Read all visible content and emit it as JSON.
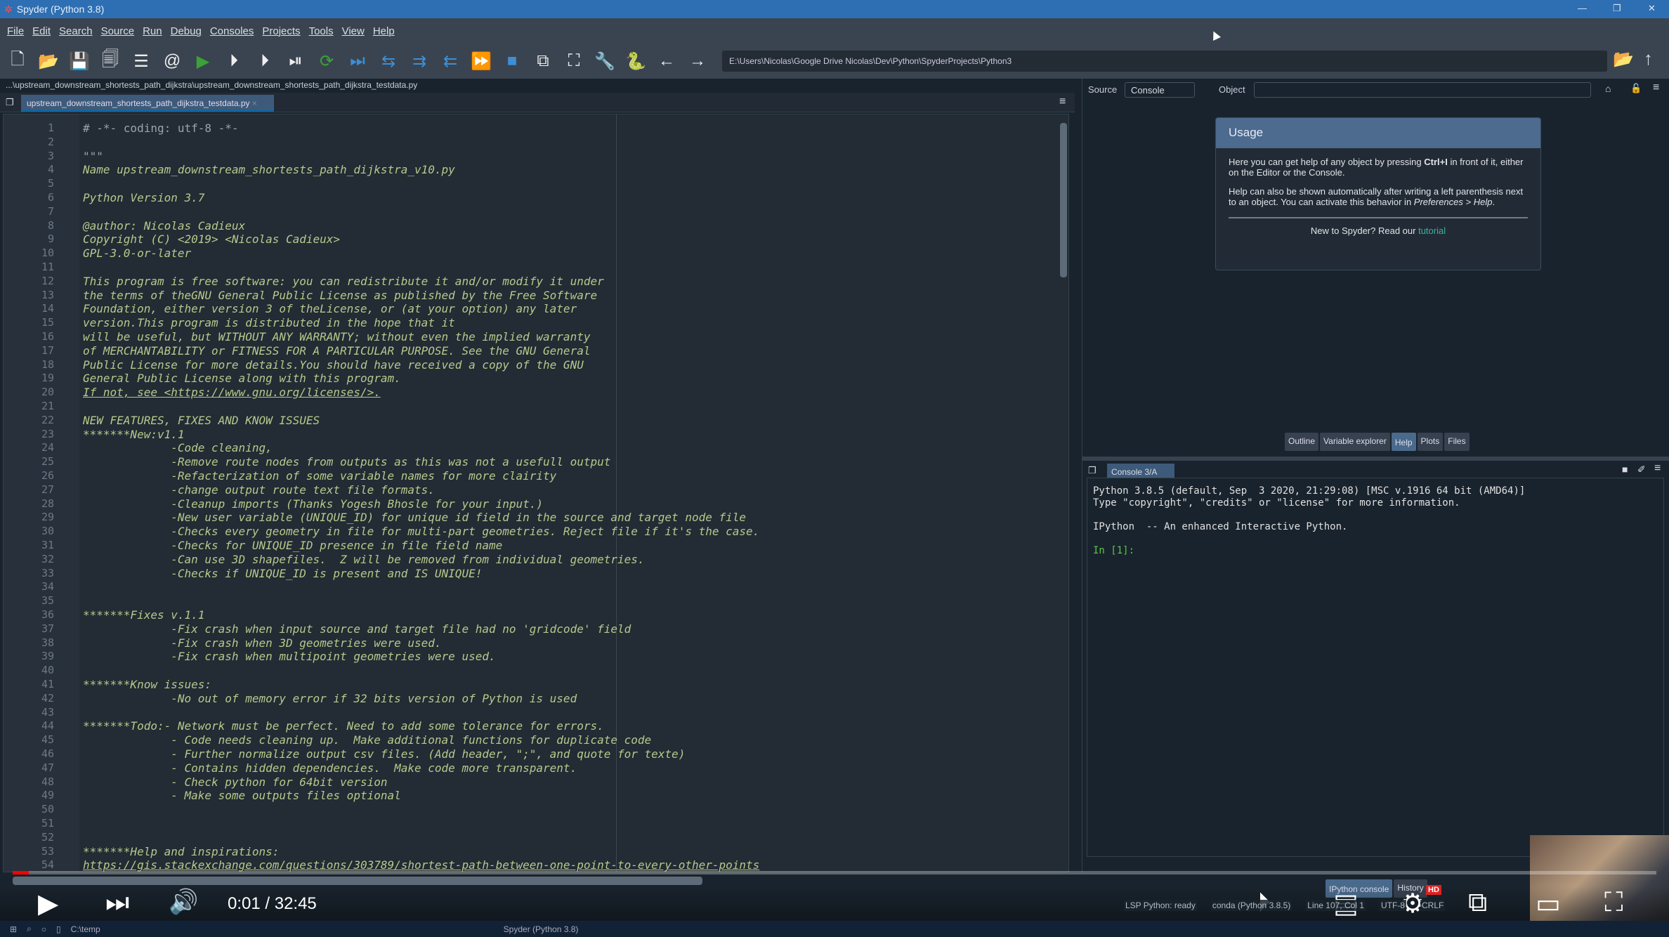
{
  "window": {
    "title": "Spyder (Python 3.8)",
    "controls": [
      "—",
      "❐",
      "✕"
    ]
  },
  "menu": [
    "File",
    "Edit",
    "Search",
    "Source",
    "Run",
    "Debug",
    "Consoles",
    "Projects",
    "Tools",
    "View",
    "Help"
  ],
  "toolbar": {
    "icons": [
      "new-file-icon",
      "open-folder-icon",
      "save-icon",
      "save-all-icon",
      "list-icon",
      "at-icon",
      "run-icon",
      "run-cell-icon",
      "run-cell-advance-icon",
      "run-selection-icon",
      "rerun-icon",
      "debug-step-icon",
      "debug-icon",
      "debug-indent-icon",
      "debug-outdent-icon",
      "continue-icon",
      "stop-icon",
      "maximize-pane-icon",
      "fullscreen-icon",
      "wrench-icon",
      "python-icon",
      "back-arrow-icon",
      "forward-arrow-icon"
    ],
    "glyphs": [
      "🗋",
      "📂",
      "💾",
      "🗐",
      "☰",
      "@",
      "▶",
      "⏵",
      "⏵",
      "⏯",
      "⟳",
      "⏭",
      "⇆",
      "⇉",
      "⇇",
      "⏩",
      "■",
      "⧉",
      "⛶",
      "🔧",
      "🐍",
      "←",
      "→"
    ],
    "working_dir": "E:\\Users\\Nicolas\\Google Drive Nicolas\\Dev\\Python\\SpyderProjects\\Python3"
  },
  "editor": {
    "breadcrumb": "...\\upstream_downstream_shortests_path_dijkstra\\upstream_downstream_shortests_path_dijkstra_testdata.py",
    "tab": "upstream_downstream_shortests_path_dijkstra_testdata.py",
    "lines": [
      "# -*- coding: utf-8 -*-",
      "",
      "\"\"\"",
      "Name upstream_downstream_shortests_path_dijkstra_v10.py",
      "",
      "Python Version 3.7",
      "",
      "@author: Nicolas Cadieux",
      "Copyright (C) <2019> <Nicolas Cadieux>",
      "GPL-3.0-or-later",
      "",
      "This program is free software: you can redistribute it and/or modify it under",
      "the terms of theGNU General Public License as published by the Free Software",
      "Foundation, either version 3 of theLicense, or (at your option) any later",
      "version.This program is distributed in the hope that it",
      "will be useful, but WITHOUT ANY WARRANTY; without even the implied warranty",
      "of MERCHANTABILITY or FITNESS FOR A PARTICULAR PURPOSE. See the GNU General",
      "Public License for more details.You should have received a copy of the GNU",
      "General Public License along with this program.",
      "If not, see <https://www.gnu.org/licenses/>.",
      "",
      "NEW FEATURES, FIXES AND KNOW ISSUES",
      "*******New:v1.1",
      "             -Code cleaning,",
      "             -Remove route nodes from outputs as this was not a usefull output",
      "             -Refacterization of some variable names for more clairity",
      "             -change output route text file formats.",
      "             -Cleanup imports (Thanks Yogesh Bhosle for your input.)",
      "             -New user variable (UNIQUE_ID) for unique id field in the source and target node file",
      "             -Checks every geometry in file for multi-part geometries. Reject file if it's the case.",
      "             -Checks for UNIQUE_ID presence in file field name",
      "             -Can use 3D shapefiles.  Z will be removed from individual geometries.",
      "             -Checks if UNIQUE_ID is present and IS UNIQUE!",
      "",
      "",
      "*******Fixes v.1.1",
      "             -Fix crash when input source and target file had no 'gridcode' field",
      "             -Fix crash when 3D geometries were used.",
      "             -Fix crash when multipoint geometries were used.",
      "",
      "*******Know issues:",
      "             -No out of memory error if 32 bits version of Python is used",
      "",
      "*******Todo:- Network must be perfect. Need to add some tolerance for errors.",
      "             - Code needs cleaning up.  Make additional functions for duplicate code",
      "             - Further normalize output csv files. (Add header, \";\", and quote for texte)",
      "             - Contains hidden dependencies.  Make code more transparent.",
      "             - Check python for 64bit version",
      "             - Make some outputs files optional",
      "",
      "",
      "",
      "*******Help and inspirations:",
      "https://gis.stackexchange.com/questions/303789/shortest-path-between-one-point-to-every-other-points"
    ]
  },
  "help": {
    "source_label": "Source",
    "source_value": "Console",
    "object_label": "Object",
    "object_value": "",
    "usage_title": "Usage",
    "p1a": "Here you can get help of any object by pressing ",
    "p1b": "Ctrl+I",
    "p1c": " in front of it, either on the Editor or the Console.",
    "p2a": "Help can also be shown automatically after writing a left parenthesis next to an object. You can activate this behavior in ",
    "p2b": "Preferences > Help",
    "p3a": "New to Spyder? Read our ",
    "p3b": "tutorial"
  },
  "dock_tabs": [
    "Outline",
    "Variable explorer",
    "Help",
    "Plots",
    "Files"
  ],
  "dock_active": "Help",
  "console": {
    "tab": "Console 3/A",
    "text": "Python 3.8.5 (default, Sep  3 2020, 21:29:08) [MSC v.1916 64 bit (AMD64)]\nType \"copyright\", \"credits\" or \"license\" for more information.\n\nIPython  -- An enhanced Interactive Python.\n",
    "prompt": "In [1]:",
    "bottom_tabs": [
      "IPython console",
      "History"
    ]
  },
  "status": {
    "lsp": "LSP Python: ready",
    "env": "conda (Python 3.8.5)",
    "line": "Line 107, Col 1",
    "encoding": "UTF-8",
    "eol": "CRLF"
  },
  "player": {
    "time": "0:01 / 32:45",
    "progress_percent": 0.05,
    "hd_badge": "HD"
  },
  "taskbar": {
    "folder": "C:\\temp",
    "app": "Spyder (Python 3.8)"
  },
  "colors": {
    "titlebar": "#2e6fb3",
    "accent": "#1464a0",
    "docstring": "#b7c98c",
    "prompt": "#5ec44a",
    "link": "#3fb0a0"
  }
}
